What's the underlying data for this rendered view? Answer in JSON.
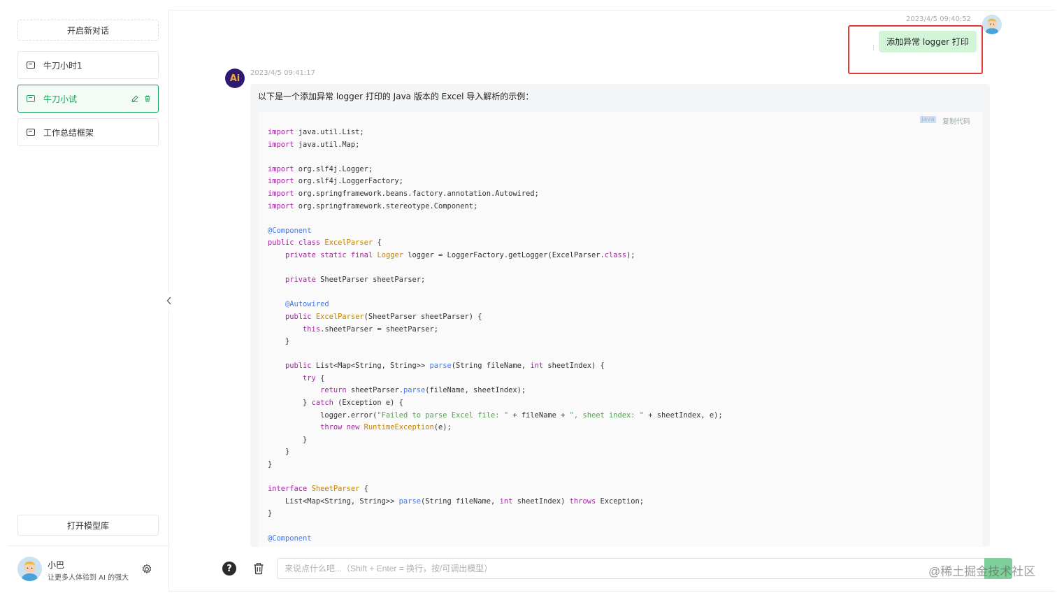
{
  "sidebar": {
    "new_chat_label": "开启新对话",
    "items": [
      {
        "label": "牛刀小时1",
        "active": false
      },
      {
        "label": "牛刀小试",
        "active": true
      },
      {
        "label": "工作总结框架",
        "active": false
      }
    ],
    "open_model_library_label": "打开模型库",
    "profile": {
      "name": "小巴",
      "description": "让更多人体验到 AI 的强大"
    }
  },
  "colors": {
    "accent": "#18a058",
    "user_bubble": "#d2f5d7",
    "highlight_box": "#e03c31"
  },
  "chat": {
    "user_message": {
      "time": "2023/4/5 09:40:52",
      "text": "添加异常 logger 打印"
    },
    "ai_message": {
      "time": "2023/4/5 09:41:17",
      "avatar_text": "Ai",
      "intro": "以下是一个添加异常 logger 打印的 Java 版本的 Excel 导入解析的示例：",
      "code": {
        "language": "java",
        "copy_label": "复制代码",
        "lines": [
          "import java.util.List;",
          "import java.util.Map;",
          "",
          "import org.slf4j.Logger;",
          "import org.slf4j.LoggerFactory;",
          "import org.springframework.beans.factory.annotation.Autowired;",
          "import org.springframework.stereotype.Component;",
          "",
          "@Component",
          "public class ExcelParser {",
          "    private static final Logger logger = LoggerFactory.getLogger(ExcelParser.class);",
          "",
          "    private SheetParser sheetParser;",
          "",
          "    @Autowired",
          "    public ExcelParser(SheetParser sheetParser) {",
          "        this.sheetParser = sheetParser;",
          "    }",
          "",
          "    public List<Map<String, String>> parse(String fileName, int sheetIndex) {",
          "        try {",
          "            return sheetParser.parse(fileName, sheetIndex);",
          "        } catch (Exception e) {",
          "            logger.error(\"Failed to parse Excel file: \" + fileName + \", sheet index: \" + sheetIndex, e);",
          "            throw new RuntimeException(e);",
          "        }",
          "    }",
          "}",
          "",
          "interface SheetParser {",
          "    List<Map<String, String>> parse(String fileName, int sheetIndex) throws Exception;",
          "}",
          "",
          "@Component"
        ]
      }
    }
  },
  "input": {
    "placeholder": "来说点什么吧...（Shift + Enter = 换行，按/可调出模型）"
  },
  "watermark": "@稀土掘金技术社区"
}
